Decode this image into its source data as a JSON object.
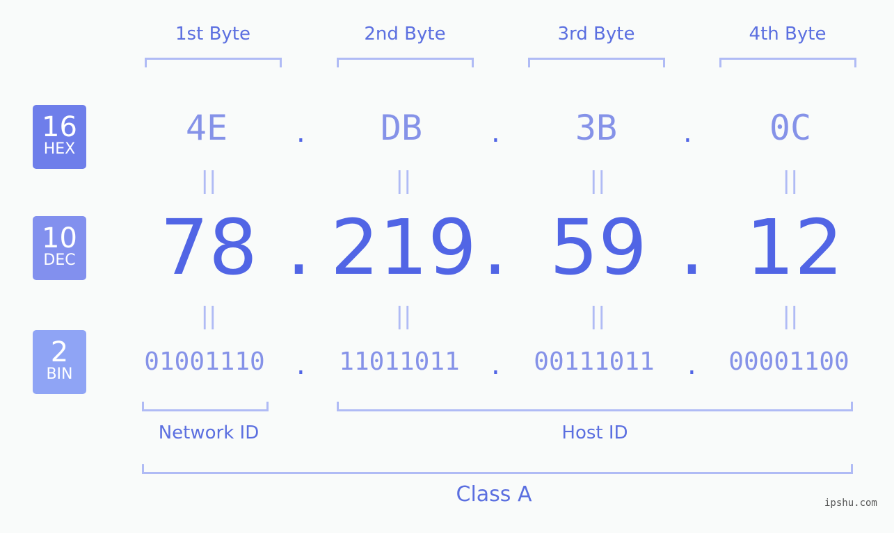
{
  "badges": [
    {
      "number": "16",
      "label": "HEX",
      "color": "#6e7eea"
    },
    {
      "number": "10",
      "label": "DEC",
      "color": "#8290ee"
    },
    {
      "number": "2",
      "label": "BIN",
      "color": "#8fa4f5"
    }
  ],
  "byte_labels": [
    "1st Byte",
    "2nd Byte",
    "3rd Byte",
    "4th Byte"
  ],
  "hex": [
    "4E",
    "DB",
    "3B",
    "0C"
  ],
  "dec": [
    "78",
    "219",
    "59",
    "12"
  ],
  "bin": [
    "01001110",
    "11011011",
    "00111011",
    "00001100"
  ],
  "separator": ".",
  "equals": "||",
  "network_label": "Network ID",
  "host_label": "Host ID",
  "class_label": "Class A",
  "watermark": "ipshu.com"
}
